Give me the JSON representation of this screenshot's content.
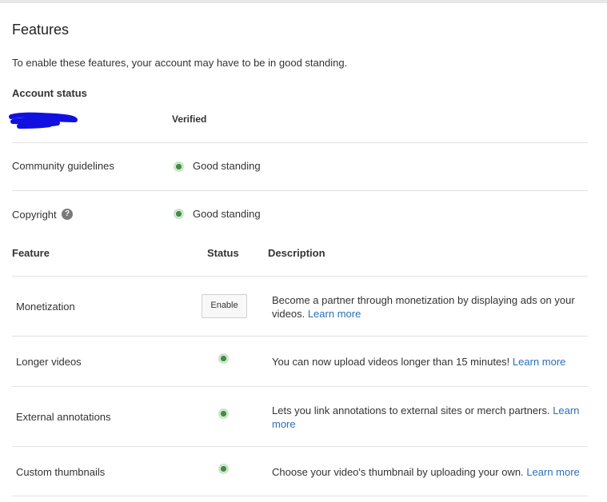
{
  "page": {
    "title": "Features",
    "intro": "To enable these features, your account may have to be in good standing."
  },
  "account_status": {
    "heading": "Account status",
    "verified_label": "Verified",
    "rows": [
      {
        "label": "Community guidelines",
        "status": "Good standing"
      },
      {
        "label": "Copyright",
        "status": "Good standing"
      }
    ]
  },
  "features": {
    "headers": {
      "feature": "Feature",
      "status": "Status",
      "description": "Description"
    },
    "rows": [
      {
        "name": "Monetization",
        "button": "Enable",
        "description": "Become a partner through monetization by displaying ads on your videos.",
        "link": "Learn more"
      },
      {
        "name": "Longer videos",
        "description": "You can now upload videos longer than 15 minutes!",
        "link": "Learn more"
      },
      {
        "name": "External annotations",
        "description": "Lets you link annotations to external sites or merch partners.",
        "link": "Learn more"
      },
      {
        "name": "Custom thumbnails",
        "description": "Choose your video's thumbnail by uploading your own.",
        "link": "Learn more"
      }
    ]
  },
  "colors": {
    "status_green": "#3a8a3a",
    "link_blue": "#2a6fb5",
    "redaction_blue": "#1010e0"
  },
  "icons": {
    "status_dot": "good-standing-dot-icon",
    "help": "help-icon",
    "redaction": "redaction-scribble"
  }
}
